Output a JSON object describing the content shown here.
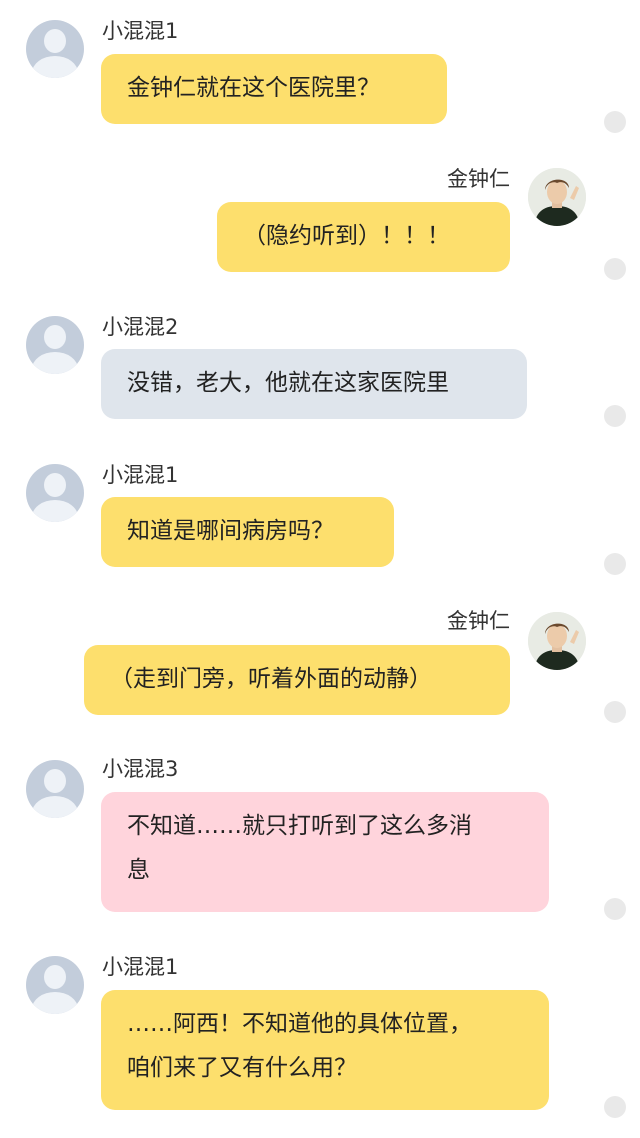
{
  "colors": {
    "yellow_bubble": "#fddf6d",
    "gray_bubble": "#dfe5ec",
    "pink_bubble": "#ffd4dc",
    "default_avatar": "#c3cddb",
    "status_dot": "#e9e9e9"
  },
  "messages": [
    {
      "sender": "小混混1",
      "side": "left",
      "avatar": "default-avatar-icon",
      "bubble_color": "yellow",
      "lines": [
        "金钟仁就在这个医院里？"
      ]
    },
    {
      "sender": "金钟仁",
      "side": "right",
      "avatar": "user-photo-avatar",
      "bubble_color": "yellow",
      "lines": [
        "（隐约听到）！！！"
      ]
    },
    {
      "sender": "小混混2",
      "side": "left",
      "avatar": "default-avatar-icon",
      "bubble_color": "gray",
      "lines": [
        "没错，老大，他就在这家医院里"
      ]
    },
    {
      "sender": "小混混1",
      "side": "left",
      "avatar": "default-avatar-icon",
      "bubble_color": "yellow",
      "lines": [
        "知道是哪间病房吗？"
      ]
    },
    {
      "sender": "金钟仁",
      "side": "right",
      "avatar": "user-photo-avatar",
      "bubble_color": "yellow",
      "lines": [
        "（走到门旁，听着外面的动静）"
      ]
    },
    {
      "sender": "小混混3",
      "side": "left",
      "avatar": "default-avatar-icon",
      "bubble_color": "pink",
      "lines": [
        "不知道……就只打听到了这么多消",
        "息"
      ]
    },
    {
      "sender": "小混混1",
      "side": "left",
      "avatar": "default-avatar-icon",
      "bubble_color": "yellow",
      "lines": [
        "……阿西！不知道他的具体位置，",
        "咱们来了又有什么用？"
      ]
    }
  ]
}
